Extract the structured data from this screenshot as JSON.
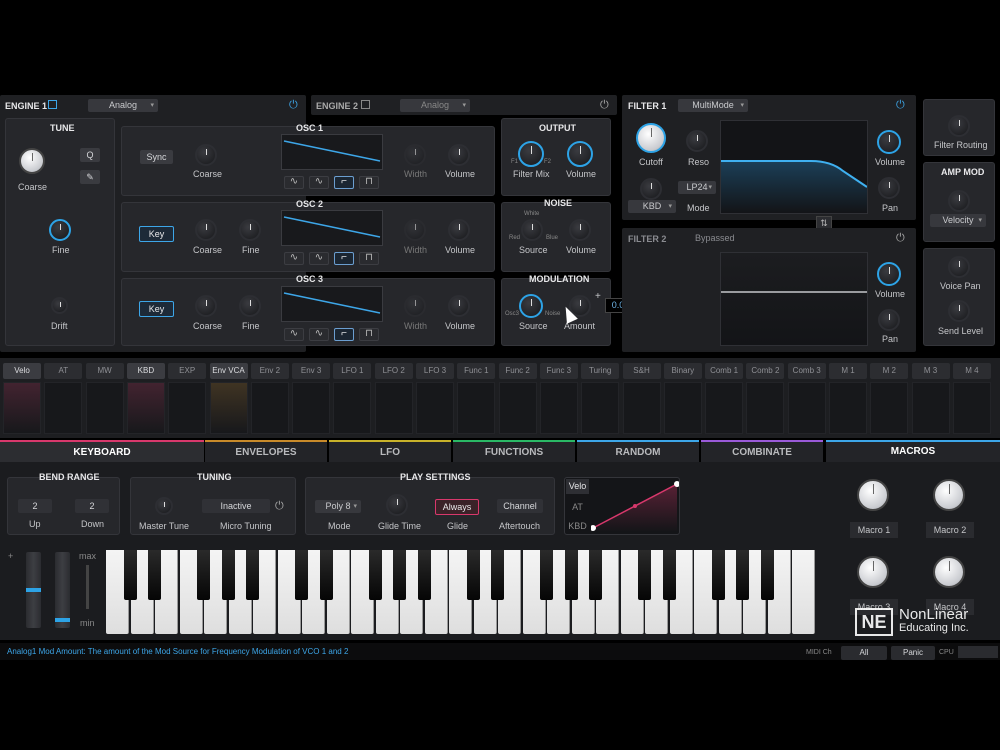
{
  "engine1": {
    "title": "ENGINE 1",
    "type": "Analog"
  },
  "engine2": {
    "title": "ENGINE 2",
    "type": "Analog"
  },
  "tune": {
    "title": "TUNE",
    "coarse": "Coarse",
    "fine": "Fine",
    "drift": "Drift",
    "q": "Q"
  },
  "osc1": {
    "title": "OSC 1",
    "sync": "Sync",
    "coarse": "Coarse",
    "width": "Width",
    "volume": "Volume"
  },
  "osc2": {
    "title": "OSC 2",
    "key": "Key",
    "coarse": "Coarse",
    "fine": "Fine",
    "width": "Width",
    "volume": "Volume"
  },
  "osc3": {
    "title": "OSC 3",
    "key": "Key",
    "coarse": "Coarse",
    "fine": "Fine",
    "width": "Width",
    "volume": "Volume"
  },
  "output": {
    "title": "OUTPUT",
    "filter_mix": "Filter Mix",
    "volume": "Volume",
    "f1": "F1",
    "f2": "F2"
  },
  "noise": {
    "title": "NOISE",
    "source": "Source",
    "volume": "Volume",
    "white": "White",
    "red": "Red",
    "blue": "Blue"
  },
  "modulation": {
    "title": "MODULATION",
    "source": "Source",
    "amount": "Amount",
    "osc3": "Osc3",
    "noise": "Noise",
    "tooltip": "0.00",
    "plus": "+"
  },
  "filter1": {
    "title": "FILTER 1",
    "type": "MultiMode",
    "cutoff": "Cutoff",
    "reso": "Reso",
    "kbd": "KBD",
    "mode_value": "LP24",
    "mode": "Mode",
    "volume": "Volume",
    "pan": "Pan"
  },
  "filter2": {
    "title": "FILTER 2",
    "status": "Bypassed",
    "volume": "Volume",
    "pan": "Pan"
  },
  "right_col": {
    "filter_routing": "Filter Routing",
    "amp_mod": "AMP MOD",
    "velocity": "Velocity",
    "voice_pan": "Voice Pan",
    "send_level": "Send Level"
  },
  "mod_sources": [
    "Velo",
    "AT",
    "MW",
    "KBD",
    "EXP",
    "Env VCA",
    "Env 2",
    "Env 3",
    "LFO 1",
    "LFO 2",
    "LFO 3",
    "Func 1",
    "Func 2",
    "Func 3",
    "Turing",
    "S&H",
    "Binary",
    "Comb 1",
    "Comb 2",
    "Comb 3",
    "M 1",
    "M 2",
    "M 3",
    "M 4"
  ],
  "bottom_tabs": [
    "KEYBOARD",
    "ENVELOPES",
    "LFO",
    "FUNCTIONS",
    "RANDOM",
    "COMBINATE"
  ],
  "macros": {
    "title": "MACROS",
    "items": [
      "Macro 1",
      "Macro 2",
      "Macro 3",
      "Macro 4"
    ]
  },
  "bend_range": {
    "title": "BEND RANGE",
    "up_value": "2",
    "down_value": "2",
    "up": "Up",
    "down": "Down"
  },
  "tuning": {
    "title": "TUNING",
    "master": "Master Tune",
    "micro_value": "Inactive",
    "micro": "Micro Tuning"
  },
  "play": {
    "title": "PLAY SETTINGS",
    "mode_value": "Poly 8",
    "mode": "Mode",
    "glide_time": "Glide Time",
    "glide_value": "Always",
    "glide": "Glide",
    "aftertouch_value": "Channel",
    "aftertouch": "Aftertouch"
  },
  "curve": {
    "velo": "Velo",
    "at": "AT",
    "kbd": "KBD"
  },
  "wheels": {
    "max": "max",
    "min": "min",
    "plus": "+",
    "minus": "−"
  },
  "watermark": {
    "line1": "NonLinear",
    "line2": "Educating Inc.",
    "logo": "NE"
  },
  "status": {
    "help": "Analog1 Mod Amount: The amount of the Mod Source for Frequency Modulation of VCO 1 and 2",
    "midi": "MIDI Ch",
    "all": "All",
    "panic": "Panic",
    "cpu": "CPU"
  }
}
